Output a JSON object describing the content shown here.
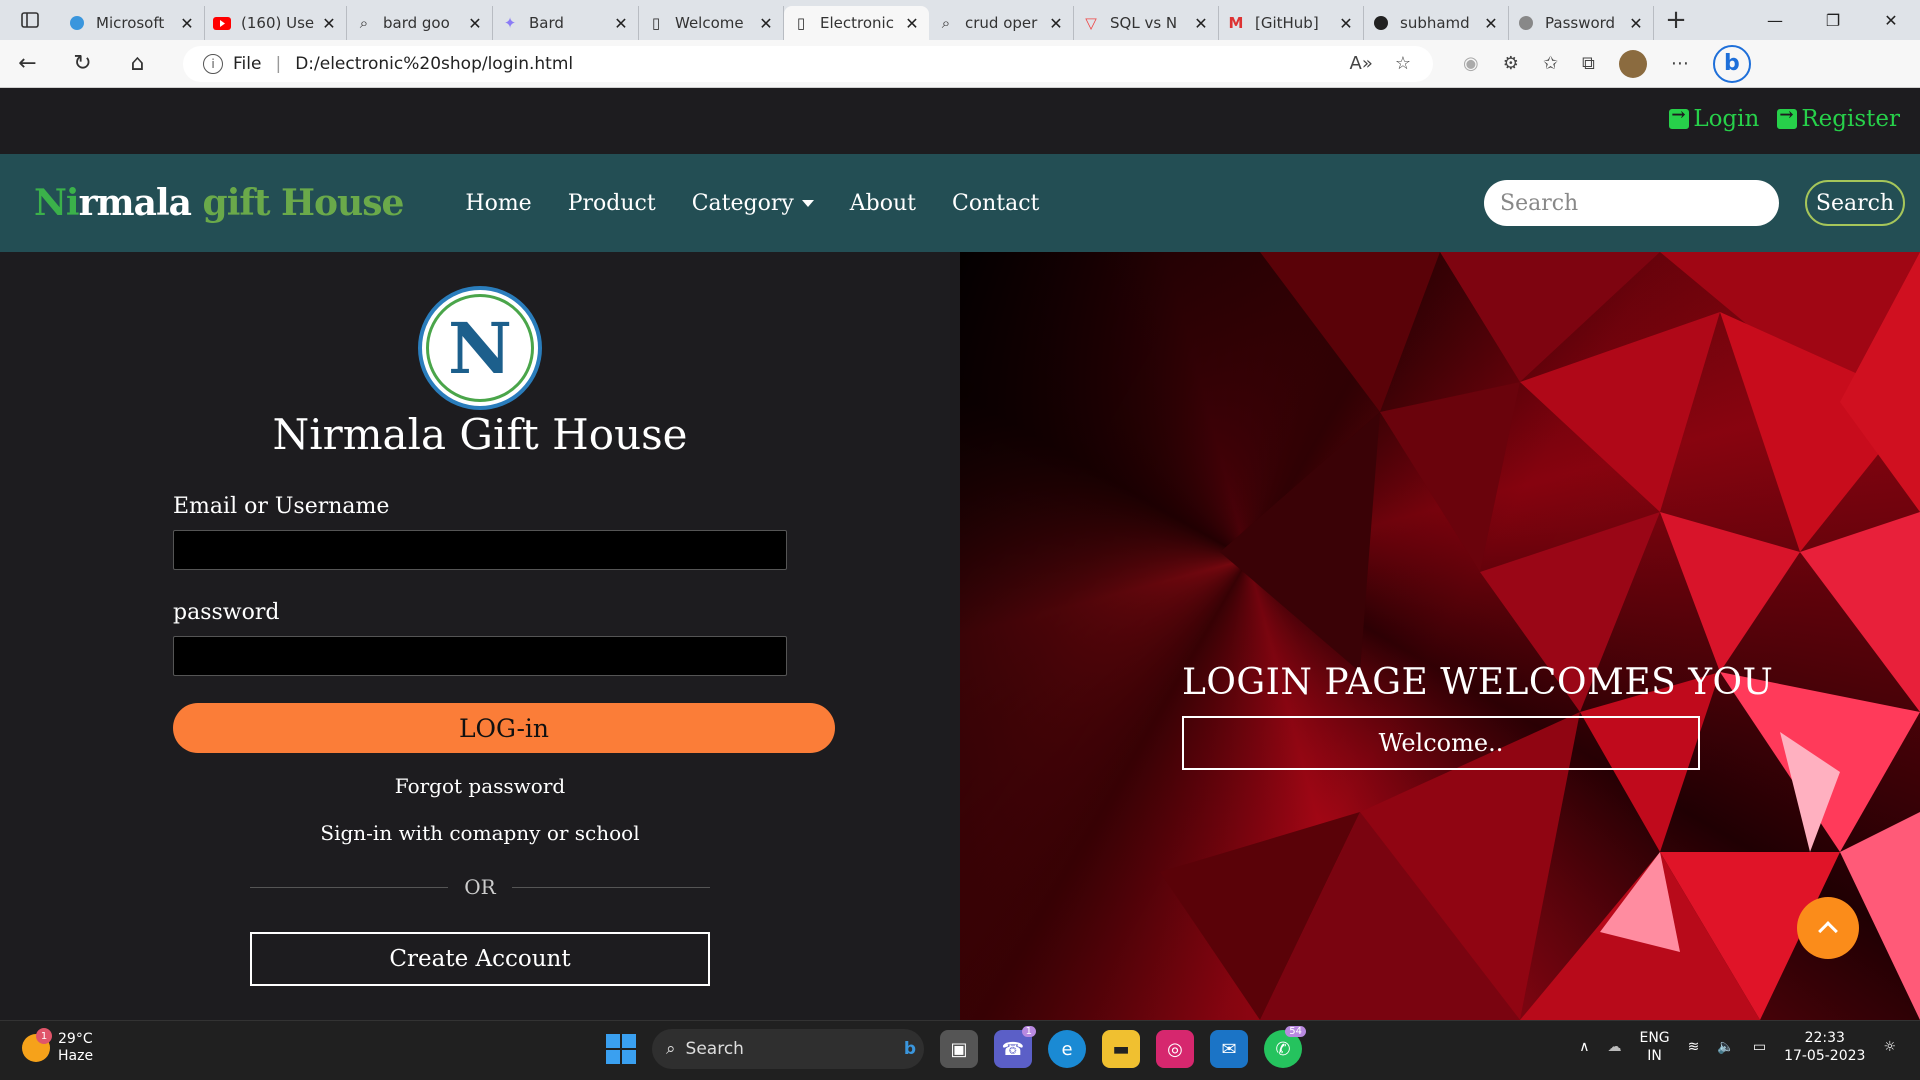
{
  "browser": {
    "tabs": [
      {
        "title": "Microsoft"
      },
      {
        "title": "(160) Use"
      },
      {
        "title": "bard goo"
      },
      {
        "title": "Bard"
      },
      {
        "title": "Welcome"
      },
      {
        "title": "Electronic"
      },
      {
        "title": "crud oper"
      },
      {
        "title": "SQL vs N"
      },
      {
        "title": "[GitHub]"
      },
      {
        "title": "subhamd"
      },
      {
        "title": "Password"
      }
    ],
    "address_prefix": "File",
    "address": "D:/electronic%20shop/login.html"
  },
  "site": {
    "top_links": {
      "login": "Login",
      "register": "Register"
    },
    "brand": {
      "part1": "Ni",
      "part2": "rmala",
      "part3": " gift House"
    },
    "nav": {
      "home": "Home",
      "product": "Product",
      "category": "Category",
      "about": "About",
      "contact": "Contact"
    },
    "search": {
      "placeholder": "Search",
      "button": "Search"
    },
    "login": {
      "logo_letter": "N",
      "site_name": "Nirmala Gift House",
      "email_label": "Email or Username",
      "password_label": "password",
      "login_button": "LOG-in",
      "forgot": "Forgot password",
      "signin_company": "Sign-in with comapny or school",
      "or": "OR",
      "create_account": "Create Account"
    },
    "welcome": {
      "title": "LOGIN PAGE WELCOMES YOU",
      "button": "Welcome.."
    }
  },
  "taskbar": {
    "weather": {
      "temp": "29°C",
      "cond": "Haze",
      "badge": "1"
    },
    "search": "Search",
    "teams_badge": "1",
    "whatsapp_badge": "54",
    "lang": "ENG",
    "region": "IN",
    "time": "22:33",
    "date": "17-05-2023"
  },
  "colors": {
    "nav_bg": "#234e54",
    "accent_orange": "#fb7d38",
    "login_link": "#27d04a"
  }
}
